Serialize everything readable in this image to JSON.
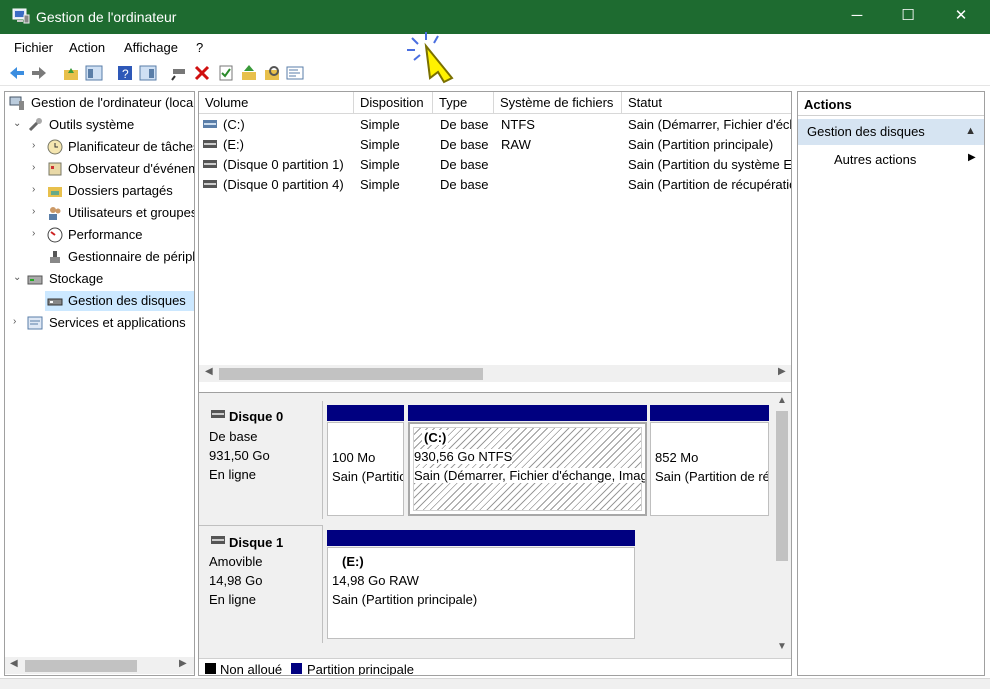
{
  "window": {
    "title": "Gestion de l'ordinateur",
    "minimize": "─",
    "maximize": "☐",
    "close": "✕"
  },
  "menu": {
    "file": "Fichier",
    "action": "Action",
    "view": "Affichage",
    "help": "?"
  },
  "toolbar": {
    "icons": [
      "back-icon",
      "forward-icon",
      "up-folder-icon",
      "show-tree-icon",
      "help-icon",
      "properties-icon",
      "connect-drive-icon",
      "delete-icon",
      "checklist-icon",
      "up-arrow-folder-icon",
      "search-folder-icon",
      "console-icon"
    ]
  },
  "tree": {
    "root": "Gestion de l'ordinateur (local)",
    "system_tools": "Outils système",
    "task_scheduler": "Planificateur de tâches",
    "event_viewer": "Observateur d'événements",
    "shared_folders": "Dossiers partagés",
    "users_groups": "Utilisateurs et groupes locaux",
    "performance": "Performance",
    "device_manager": "Gestionnaire de périphériques",
    "storage": "Stockage",
    "disk_management": "Gestion des disques",
    "services_apps": "Services et applications"
  },
  "volumes": {
    "headers": {
      "volume": "Volume",
      "layout": "Disposition",
      "type": "Type",
      "fs": "Système de fichiers",
      "status": "Statut"
    },
    "rows": [
      {
        "volume": "(C:)",
        "layout": "Simple",
        "type": "De base",
        "fs": "NTFS",
        "status": "Sain (Démarrer, Fichier d'échange, Image mémoire, Partition principale)"
      },
      {
        "volume": "(E:)",
        "layout": "Simple",
        "type": "De base",
        "fs": "RAW",
        "status": "Sain (Partition principale)"
      },
      {
        "volume": "(Disque 0 partition 1)",
        "layout": "Simple",
        "type": "De base",
        "fs": "",
        "status": "Sain (Partition du système EFI)"
      },
      {
        "volume": "(Disque 0 partition 4)",
        "layout": "Simple",
        "type": "De base",
        "fs": "",
        "status": "Sain (Partition de récupération)"
      }
    ]
  },
  "disk0": {
    "name": "Disque 0",
    "kind": "De base",
    "size": "931,50 Go",
    "state": "En ligne",
    "p1": {
      "size": "100 Mo",
      "status": "Sain (Partition du système EFI)"
    },
    "p2": {
      "label": "(C:)",
      "size": "930,56 Go NTFS",
      "status": "Sain (Démarrer, Fichier d'échange, Image mémoire, Partition principale)"
    },
    "p3": {
      "size": "852 Mo",
      "status": "Sain (Partition de récupération)"
    }
  },
  "disk1": {
    "name": "Disque 1",
    "kind": "Amovible",
    "size": "14,98 Go",
    "state": "En ligne",
    "p1": {
      "label": "(E:)",
      "size": "14,98 Go RAW",
      "status": "Sain (Partition principale)"
    }
  },
  "legend": {
    "unallocated": "Non alloué",
    "primary": "Partition principale",
    "unallocated_color": "#000000",
    "primary_color": "#000080"
  },
  "actions": {
    "header": "Actions",
    "group": "Gestion des disques",
    "more": "Autres actions"
  },
  "colors": {
    "titlebar": "#1e6b30",
    "partition_bar": "#000080",
    "selection": "#cce8ff"
  }
}
